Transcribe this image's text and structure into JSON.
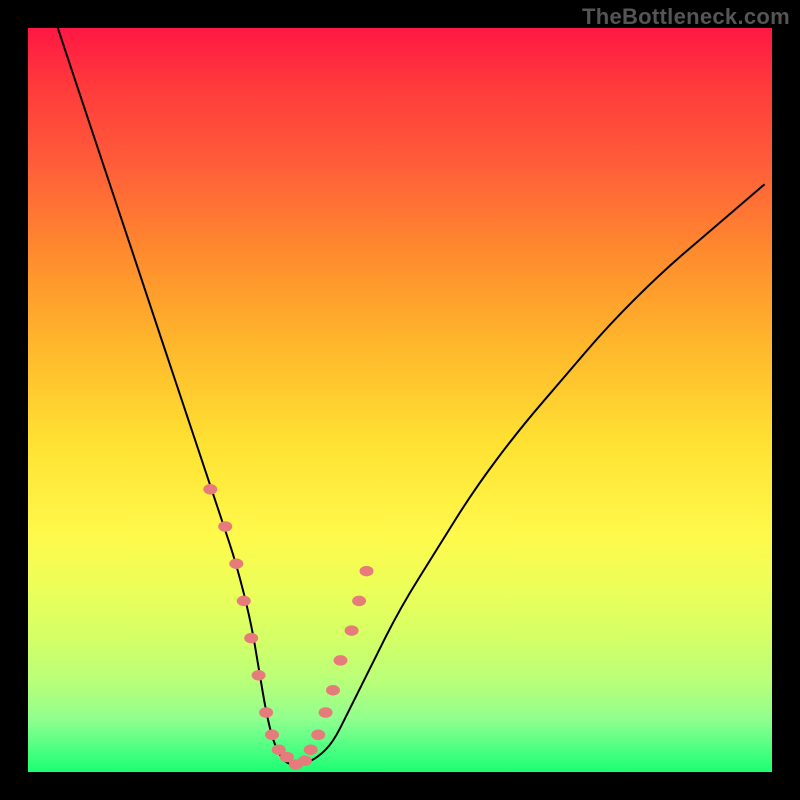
{
  "watermark": "TheBottleneck.com",
  "chart_data": {
    "type": "line",
    "title": "",
    "xlabel": "",
    "ylabel": "",
    "xlim": [
      0,
      100
    ],
    "ylim": [
      0,
      100
    ],
    "grid": false,
    "legend": false,
    "series": [
      {
        "name": "curve",
        "color": "#000000",
        "stroke_width": 2,
        "x": [
          4,
          8,
          12,
          16,
          20,
          24,
          26,
          28,
          30,
          31,
          32,
          33,
          34,
          35,
          37,
          39,
          41,
          43,
          46,
          50,
          55,
          60,
          66,
          72,
          78,
          85,
          92,
          99
        ],
        "values": [
          100,
          88,
          76,
          64,
          52,
          40,
          34,
          28,
          20,
          14,
          8,
          4,
          2,
          1,
          1,
          2,
          4,
          8,
          14,
          22,
          30,
          38,
          46,
          53,
          60,
          67,
          73,
          79
        ]
      },
      {
        "name": "points",
        "color": "#e77b7b",
        "marker": "point",
        "point_radius": 7,
        "x": [
          24.5,
          26.5,
          28.0,
          29.0,
          30.0,
          31.0,
          32.0,
          32.8,
          33.7,
          34.8,
          36.0,
          37.2,
          38.0,
          39.0,
          40.0,
          41.0,
          42.0,
          43.5,
          44.5,
          45.5
        ],
        "values": [
          38,
          33,
          28,
          23,
          18,
          13,
          8,
          5,
          3,
          2,
          1,
          1.5,
          3,
          5,
          8,
          11,
          15,
          19,
          23,
          27
        ]
      }
    ],
    "background_gradient": {
      "direction": "vertical",
      "stops": [
        {
          "pos": 0.0,
          "color": "#ff1744"
        },
        {
          "pos": 0.3,
          "color": "#ff8a2e"
        },
        {
          "pos": 0.56,
          "color": "#ffe233"
        },
        {
          "pos": 0.82,
          "color": "#d4ff66"
        },
        {
          "pos": 1.0,
          "color": "#1aff73"
        }
      ]
    }
  }
}
